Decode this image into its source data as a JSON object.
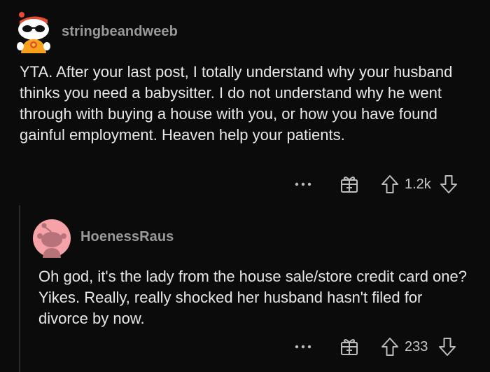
{
  "comments": [
    {
      "username": "stringbeandweeb",
      "body": "YTA. After your last post, I totally understand why your husband thinks you need a babysitter. I do not understand why he went through with buying a house with you, or how you have found gainful employment. Heaven help your patients.",
      "score": "1.2k",
      "avatar": "snoo-sunglasses-avatar",
      "accent_color": "#e84a33"
    },
    {
      "username": "HoenessRaus",
      "body": "Oh god, it's the lady from the house sale/store credit card one? Yikes. Really, really shocked her husband hasn't filed for divorce by now.",
      "score": "233",
      "avatar": "default-snoo-avatar",
      "accent_color": "#f5a3a8"
    }
  ],
  "icons": {
    "more": "more-options-icon",
    "award": "gift-award-icon",
    "upvote": "upvote-arrow-icon",
    "downvote": "downvote-arrow-icon"
  }
}
